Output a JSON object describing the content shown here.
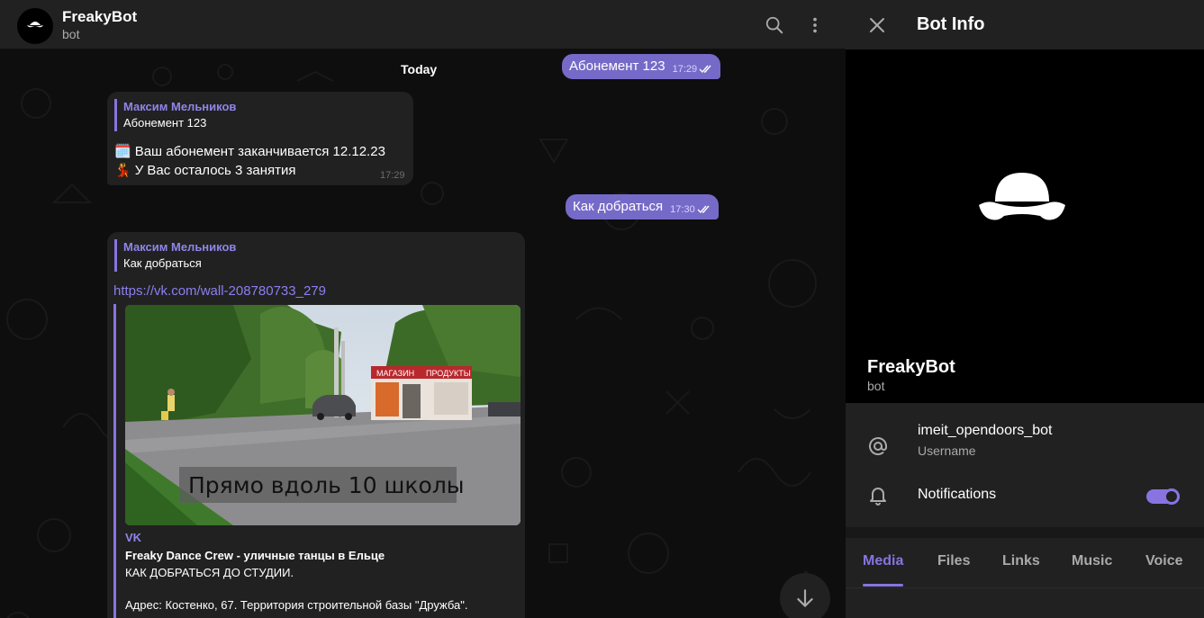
{
  "header": {
    "title": "FreakyBot",
    "subtitle": "bot",
    "icons": [
      "search-icon",
      "more-vertical-icon"
    ]
  },
  "chat": {
    "date_label": "Today",
    "messages": [
      {
        "direction": "out",
        "text": "Абонемент 123",
        "time": "17:29",
        "status": "read"
      },
      {
        "direction": "in",
        "reply_author": "Максим Мельников",
        "reply_text": "Абонемент 123",
        "lines": [
          {
            "emoji": "🗓️",
            "text": "Ваш абонемент заканчивается 12.12.23"
          },
          {
            "emoji": "💃",
            "text": "У Вас осталось 3 занятия"
          }
        ],
        "time": "17:29"
      },
      {
        "direction": "out",
        "text": "Как добраться",
        "time": "17:30",
        "status": "read"
      },
      {
        "direction": "in",
        "reply_author": "Максим Мельников",
        "reply_text": "Как добраться",
        "link": "https://vk.com/wall-208780733_279",
        "preview": {
          "site": "VK",
          "title": "Freaky Dance Crew - уличные танцы в Ельце",
          "description_1": "КАК ДОБРАТЬСЯ ДО СТУДИИ.",
          "description_2": "Адрес: Костенко, 67. Территория строительной базы \"Дружба\".",
          "image_caption": "Прямо вдоль 10 школы",
          "sign_left": "МАГАЗИН",
          "sign_right": "ПРОДУКТЫ"
        }
      }
    ]
  },
  "info_panel": {
    "title": "Bot Info",
    "name": "FreakyBot",
    "status": "bot",
    "username": "imeit_opendoors_bot",
    "username_label": "Username",
    "notifications_label": "Notifications",
    "notifications_enabled": true,
    "tabs": [
      "Media",
      "Files",
      "Links",
      "Music",
      "Voice"
    ],
    "active_tab": "Media"
  },
  "colors": {
    "accent": "#8774e1",
    "outgoing_bubble": "#766ac8",
    "incoming_bubble": "#212121",
    "panel": "#212121",
    "chat_background": "#0e0e0e"
  }
}
